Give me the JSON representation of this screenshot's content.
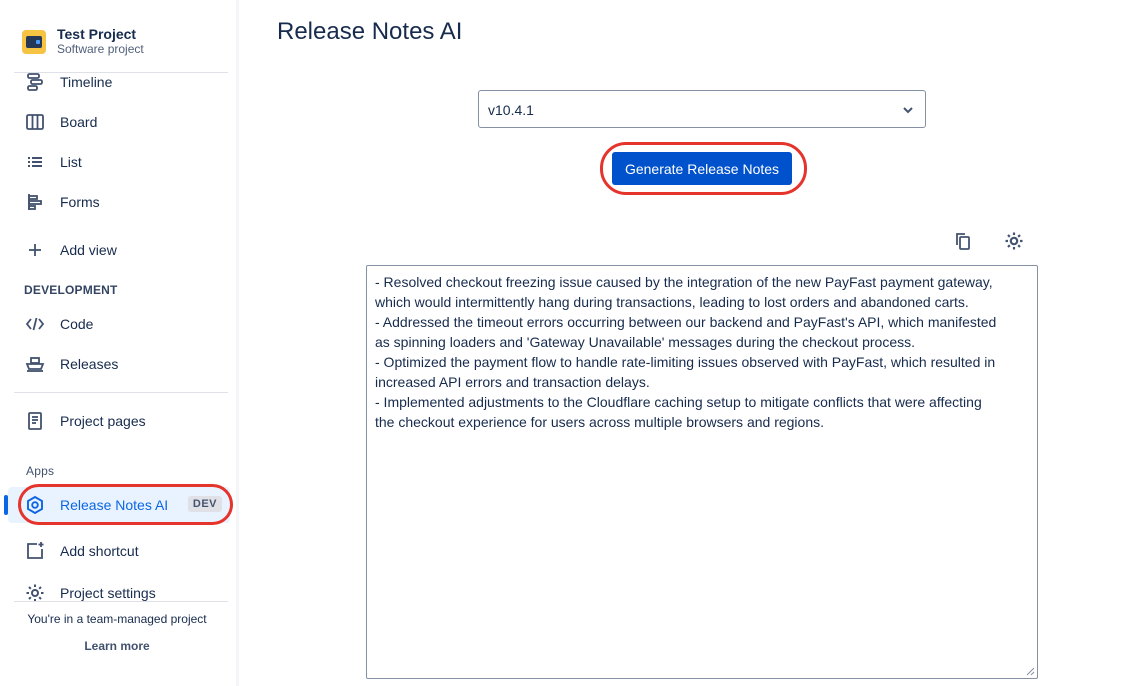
{
  "sidebar": {
    "project_name": "Test Project",
    "project_type": "Software project",
    "items": [
      {
        "label": "Timeline",
        "icon": "timeline-icon"
      },
      {
        "label": "Board",
        "icon": "board-icon"
      },
      {
        "label": "List",
        "icon": "list-icon"
      },
      {
        "label": "Forms",
        "icon": "forms-icon"
      },
      {
        "label": "Add view",
        "icon": "plus-icon"
      }
    ],
    "development_label": "DEVELOPMENT",
    "dev_items": [
      {
        "label": "Code",
        "icon": "code-icon"
      },
      {
        "label": "Releases",
        "icon": "ship-icon"
      }
    ],
    "project_pages": "Project pages",
    "apps_label": "Apps",
    "app_item": {
      "label": "Release Notes AI",
      "badge": "DEV"
    },
    "add_shortcut": "Add shortcut",
    "project_settings": "Project settings",
    "footer_text": "You're in a team-managed project",
    "learn_more": "Learn more"
  },
  "main": {
    "title": "Release Notes AI",
    "version_select": {
      "value": "v10.4.1"
    },
    "generate_button": "Generate Release Notes",
    "notes": [
      "- Resolved checkout freezing issue caused by the integration of the new PayFast payment gateway,",
      "which would intermittently hang during transactions, leading to lost orders and abandoned carts.",
      "- Addressed the timeout errors occurring between our backend and PayFast's API, which manifested",
      "as spinning loaders and 'Gateway Unavailable' messages during the checkout process.",
      "- Optimized the payment flow to handle rate-limiting issues observed with PayFast, which resulted in",
      "increased API errors and transaction delays.",
      "- Implemented adjustments to the Cloudflare caching setup to mitigate conflicts that were affecting",
      "the checkout experience for users across multiple browsers and regions."
    ]
  },
  "colors": {
    "primary": "#0052cc",
    "highlight": "#e5342c",
    "active_bg": "#e9f2ff"
  }
}
